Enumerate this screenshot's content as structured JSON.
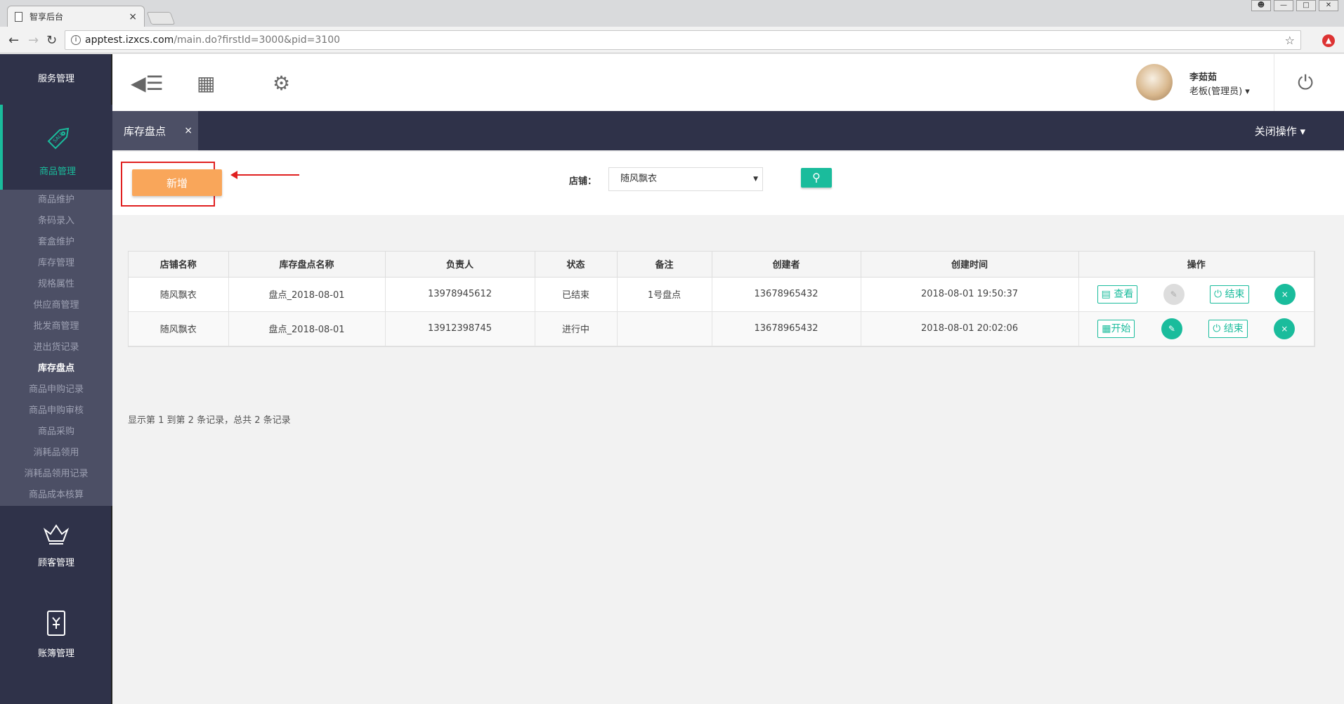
{
  "browser": {
    "tab_title": "智享后台",
    "tab_close": "×",
    "url_host": "apptest.izxcs.com",
    "url_path": "/main.do?firstId=3000&pid=3100"
  },
  "sidebar": {
    "service_label": "服务管理",
    "goods_label": "商品管理",
    "customer_label": "顾客管理",
    "ledger_label": "账簿管理",
    "submenu": [
      "商品维护",
      "条码录入",
      "套盒维护",
      "库存管理",
      "规格属性",
      "供应商管理",
      "批发商管理",
      "进出货记录",
      "库存盘点",
      "商品申购记录",
      "商品申购审核",
      "商品采购",
      "消耗品领用",
      "消耗品领用记录",
      "商品成本核算"
    ],
    "active_index": 8
  },
  "topbar": {
    "user_name": "李茹茹",
    "user_role": "老板(管理员) ▾"
  },
  "tabbar": {
    "page_tab": "库存盘点",
    "page_tab_close": "×",
    "close_ops": "关闭操作 ▾"
  },
  "toolbar": {
    "add_label": "新增",
    "shop_label": "店铺：",
    "shop_value": "随风飘衣"
  },
  "table": {
    "headers": [
      "店铺名称",
      "库存盘点名称",
      "负责人",
      "状态",
      "备注",
      "创建者",
      "创建时间",
      "操作"
    ],
    "rows": [
      {
        "shop": "随风飘衣",
        "name": "盘点_2018-08-01",
        "owner": "13978945612",
        "status": "已结束",
        "remark": "1号盘点",
        "creator": "13678965432",
        "created": "2018-08-01 19:50:37",
        "op1": "查看",
        "op3": "结束",
        "op4": "×"
      },
      {
        "shop": "随风飘衣",
        "name": "盘点_2018-08-01",
        "owner": "13912398745",
        "status": "进行中",
        "remark": "",
        "creator": "13678965432",
        "created": "2018-08-01 20:02:06",
        "op1": "开始",
        "op3": "结束",
        "op4": "×"
      }
    ]
  },
  "summary": "显示第 1 到第 2 条记录，总共 2 条记录",
  "colors": {
    "accent": "#1abc9c",
    "sidebar": "#2f3249",
    "add_button": "#f9a65a",
    "highlight": "#e02020"
  }
}
